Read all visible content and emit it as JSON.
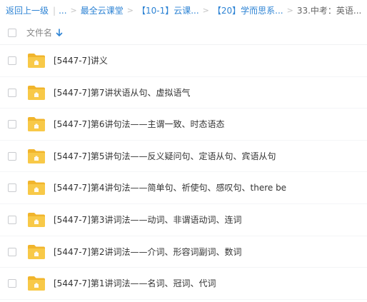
{
  "breadcrumb": {
    "back": "返回上一级",
    "ellipsis": "...",
    "items": [
      "最全云课堂",
      "【10-1】云课...",
      "【20】学而思系...",
      "33.中考：英语..."
    ]
  },
  "header": {
    "name_column": "文件名"
  },
  "files": [
    "[5447-7]讲义",
    "[5447-7]第7讲状语从句、虚拟语气",
    "[5447-7]第6讲句法——主谓一致、时态语态",
    "[5447-7]第5讲句法——反义疑问句、定语从句、宾语从句",
    "[5447-7]第4讲句法——简单句、祈使句、感叹句、there be",
    "[5447-7]第3讲词法——动词、非谓语动词、连词",
    "[5447-7]第2讲词法——介词、形容词副词、数词",
    "[5447-7]第1讲词法——名词、冠词、代词"
  ],
  "colors": {
    "link": "#2d83d4",
    "folder": "#f8c948",
    "folder_dark": "#f1b52c",
    "text": "#333333"
  }
}
